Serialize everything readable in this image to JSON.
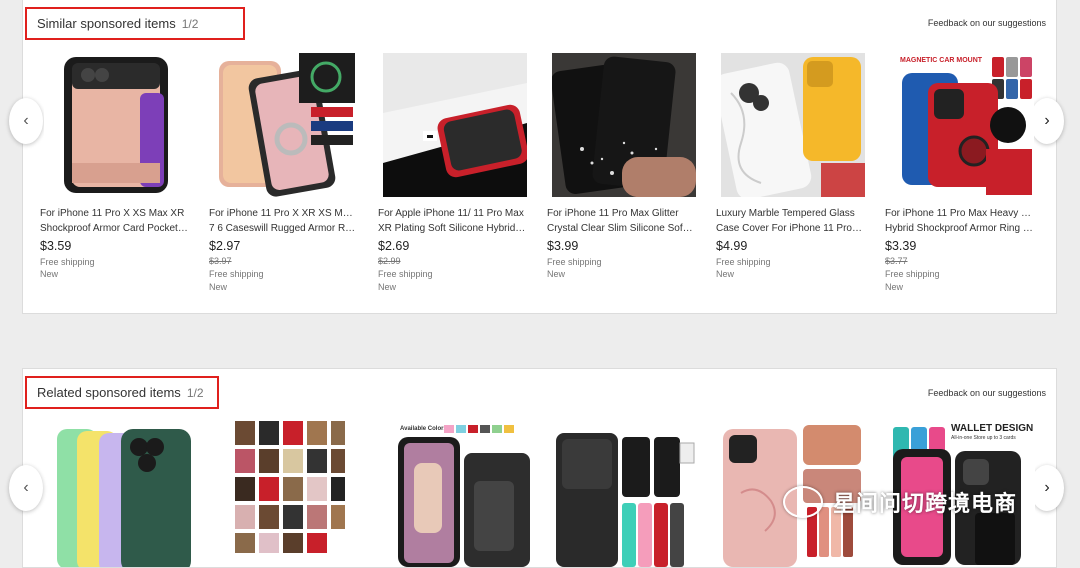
{
  "similar": {
    "title": "Similar sponsored items",
    "page": "1/2",
    "feedback": "Feedback on our suggestions",
    "items": [
      {
        "title1": "For iPhone 11 Pro X XS Max XR",
        "title2": "Shockproof Armor Card Pocket…",
        "price": "$3.59",
        "old_price": "",
        "shipping": "Free shipping",
        "condition": "New"
      },
      {
        "title1": "For iPhone 11 Pro X XR XS Max 8",
        "title2": "7 6 Caseswill Rugged Armor Rin…",
        "price": "$2.97",
        "old_price": "$3.97",
        "shipping": "Free shipping",
        "condition": "New"
      },
      {
        "title1": "For Apple iPhone 11/ 11 Pro Max",
        "title2": "XR Plating Soft Silicone Hybrid C…",
        "price": "$2.69",
        "old_price": "$2.99",
        "shipping": "Free shipping",
        "condition": "New"
      },
      {
        "title1": "For iPhone 11 Pro Max Glitter",
        "title2": "Crystal Clear Slim Silicone Soft…",
        "price": "$3.99",
        "old_price": "",
        "shipping": "Free shipping",
        "condition": "New"
      },
      {
        "title1": "Luxury Marble Tempered Glass",
        "title2": "Case Cover For iPhone 11 Pro X…",
        "price": "$4.99",
        "old_price": "",
        "shipping": "Free shipping",
        "condition": "New"
      },
      {
        "title1": "For iPhone 11 Pro Max Heavy Duty",
        "title2": "Hybrid Shockproof Armor Ring St…",
        "price": "$3.39",
        "old_price": "$3.77",
        "shipping": "Free shipping",
        "condition": "New"
      }
    ],
    "image_texts": {
      "magnetic": "MAGNETIC CAR MOUNT"
    }
  },
  "related": {
    "title": "Related sponsored items",
    "page": "1/2",
    "feedback": "Feedback on our suggestions",
    "image_texts": {
      "colors": "Available Colors:",
      "wallet": "WALLET DESIGN",
      "wallet_sub": "All-in-one Store up to 3 cards"
    }
  },
  "watermark": "星间问切跨境电商",
  "colors": {
    "highlight": "#e0201d",
    "rose": "#e8b5a4",
    "phone_black": "#1b1b1b",
    "red_case": "#c8202a"
  },
  "icons": {
    "left": "chevron-left-icon",
    "right": "chevron-right-icon",
    "watermark": "wechat-icon"
  }
}
